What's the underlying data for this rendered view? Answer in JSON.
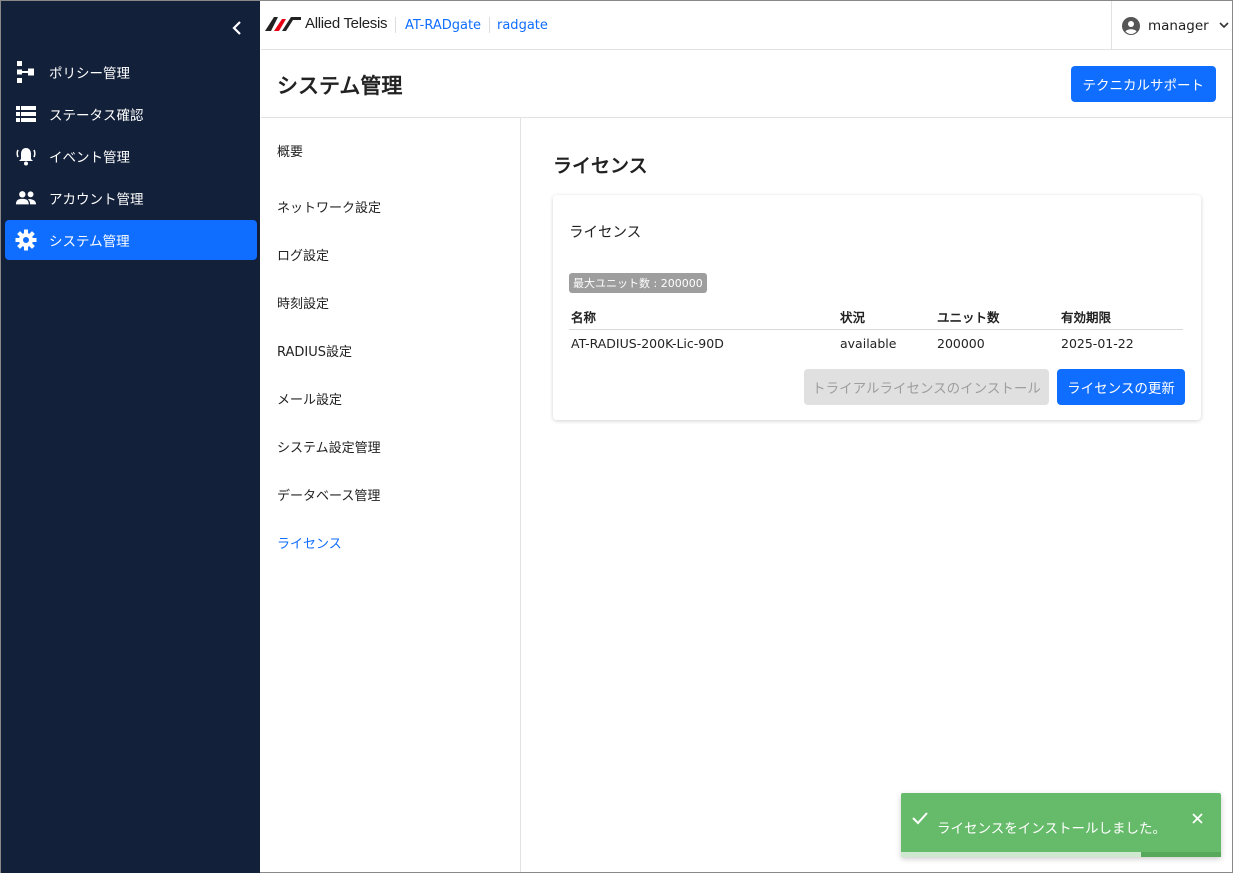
{
  "sidebar": {
    "collapse_icon": "chevron-left-icon",
    "items": [
      {
        "label": "ポリシー管理",
        "icon": "policy-tree-icon"
      },
      {
        "label": "ステータス確認",
        "icon": "list-icon"
      },
      {
        "label": "イベント管理",
        "icon": "bell-icon"
      },
      {
        "label": "アカウント管理",
        "icon": "people-icon"
      },
      {
        "label": "システム管理",
        "icon": "gear-icon",
        "active": true
      }
    ]
  },
  "header": {
    "logo_text": "Allied Telesis",
    "product": "AT-RADgate",
    "host": "radgate",
    "user": "manager"
  },
  "page": {
    "title": "システム管理",
    "support_button": "テクニカルサポート"
  },
  "submenu": {
    "items": [
      "概要",
      "ネットワーク設定",
      "ログ設定",
      "時刻設定",
      "RADIUS設定",
      "メール設定",
      "システム設定管理",
      "データベース管理",
      "ライセンス"
    ],
    "active_index": 8
  },
  "license": {
    "section_title": "ライセンス",
    "card_title": "ライセンス",
    "max_units_chip": "最大ユニット数 : 200000",
    "columns": [
      "名称",
      "状況",
      "ユニット数",
      "有効期限"
    ],
    "rows": [
      [
        "AT-RADIUS-200K-Lic-90D",
        "available",
        "200000",
        "2025-01-22"
      ]
    ],
    "trial_button": "トライアルライセンスのインストール",
    "update_button": "ライセンスの更新"
  },
  "toast": {
    "message": "ライセンスをインストールしました。",
    "progress": 0.75
  },
  "colors": {
    "sidebar_bg": "#13203a",
    "accent": "#0f6dff",
    "toast_bg": "#66bb6a",
    "logo_red": "#e60012"
  }
}
